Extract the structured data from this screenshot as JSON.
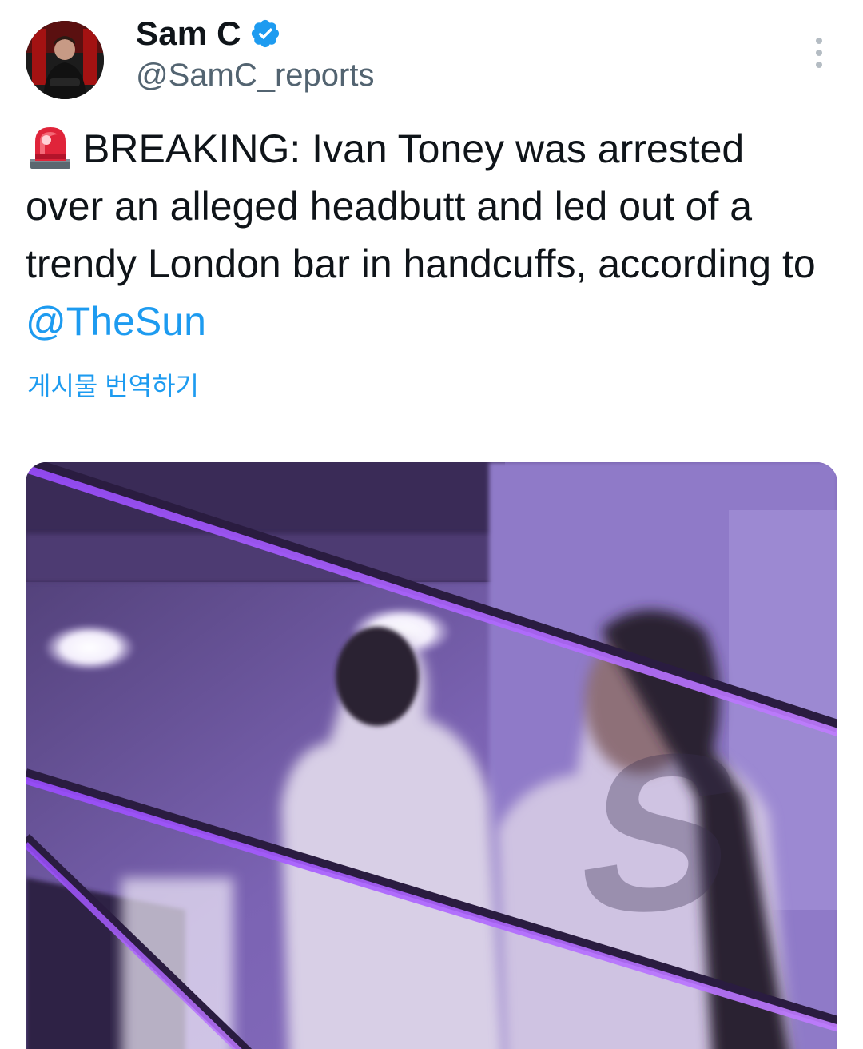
{
  "author": {
    "display_name": "Sam C",
    "handle": "@SamC_reports",
    "verified": true
  },
  "tweet": {
    "emoji_icon": "rotating-light-icon",
    "text_before": "BREAKING: Ivan Toney was arrested over an alleged headbutt and led out of a trendy London bar in handcuffs, according to ",
    "mention": "@TheSun",
    "translate_label": "게시물 번역하기"
  },
  "media": {
    "kind": "photo"
  },
  "colors": {
    "link": "#1d9bf0",
    "verified_badge": "#1d9bf0",
    "secondary_text": "#536471"
  }
}
